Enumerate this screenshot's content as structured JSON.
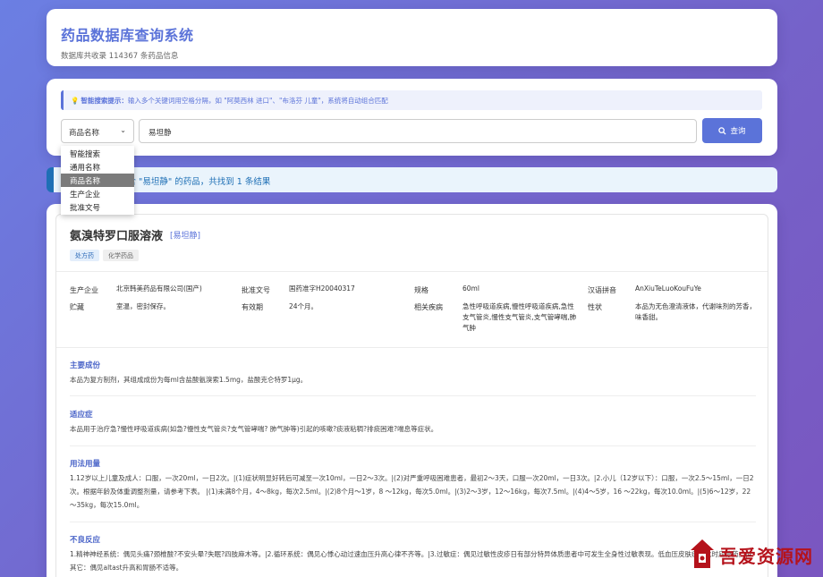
{
  "header": {
    "title": "药品数据库查询系统",
    "subtitle": "数据库共收录 114367 条药品信息"
  },
  "search": {
    "tip_label": "智能搜索提示：",
    "tip_text": "输入多个关键词用空格分隔，如 \"阿莫西林 进口\"、\"布洛芬 儿童\"，系统将自动组合匹配",
    "select_value": "商品名称",
    "input_value": "易坦静",
    "button_label": "查询",
    "options": [
      "智能搜索",
      "通用名称",
      "商品名称",
      "生产企业",
      "批准文号"
    ]
  },
  "result": {
    "summary": "找到商品名称包含 \"易坦静\" 的药品，共找到 1 条结果"
  },
  "drug": {
    "name": "氨溴特罗口服溶液",
    "trade_name": "[易坦静]",
    "tags": [
      "处方药",
      "化学药品"
    ],
    "info": {
      "manufacturer_label": "生产企业",
      "manufacturer": "北京韩美药品有限公司(国产)",
      "approval_label": "批准文号",
      "approval": "国药准字H20040317",
      "spec_label": "规格",
      "spec": "60ml",
      "pinyin_label": "汉语拼音",
      "pinyin": "AnXiuTeLuoKouFuYe",
      "storage_label": "贮藏",
      "storage": "室温，密封保存。",
      "validity_label": "有效期",
      "validity": "24个月。",
      "disease_label": "相关疾病",
      "disease": "急性呼吸道疾病,慢性呼吸道疾病,急性支气管炎,慢性支气管炎,支气管哮喘,肺气肿",
      "property_label": "性状",
      "property": "本品为无色澄清液体，代谢味剂的芳香，味香甜。"
    },
    "sections": [
      {
        "title": "主要成份",
        "text": "本品为复方制剂，其组成成份为每ml含盐酸氨溴索1.5mg，盐酸克仑特罗1μg。"
      },
      {
        "title": "适应症",
        "text": "本品用于治疗急?慢性呼吸道疾病(如急?慢性支气管炎?支气管哮喘? 肺气肿等)引起的咳嗽?痰液粘稠?排痰困难?喘息等症状。"
      },
      {
        "title": "用法用量",
        "text": "1.12岁以上儿童及成人：口服，一次20ml，一日2次。|(1)症状明显好转后可减至一次10ml，一日2～3次。|(2)对严重呼吸困难患者，最初2～3天，口服一次20ml，一日3次。|2.小儿（12岁以下）：口服，一次2.5～15ml，一日2次。根据年龄及体重调整剂量，请参考下表。   |(1)未满8个月，4～8kg，每次2.5ml。|(2)8个月～1岁，8 ～12kg，每次5.0ml。|(3)2～3岁，12～16kg，每次7.5ml。|(4)4～5岁，16 ～22kg，每次10.0ml。|(5)6～12岁，22～35kg，每次15.0ml。"
      },
      {
        "title": "不良反应",
        "text": "1.精神神经系统：偶见头痛?颈椎酸?不安头晕?失眠?四肢麻木等。|2.循环系统：偶见心悸心动过速血压升高心律不齐等。|3.过敏症：偶见过敏性皮疹日有部分特异体质患者中可发生全身性过敏表现。低血压皮肤症等此时应停药。|4.其它：偶见altast升高和胃肠不适等。"
      }
    ]
  },
  "watermark": {
    "text": "吾爱资源网"
  }
}
